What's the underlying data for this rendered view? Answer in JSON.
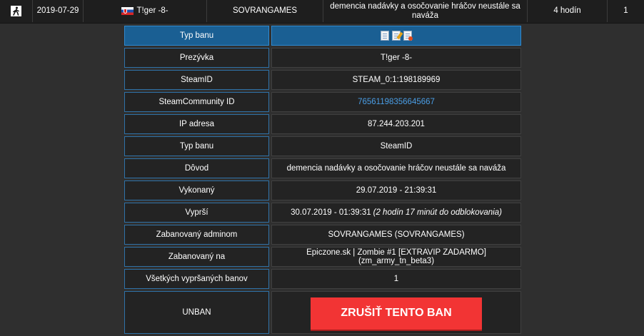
{
  "ban_row": {
    "game_icon": "person-walking-icon",
    "date": "2019-07-29",
    "player": "T!ger -8-",
    "country_flag": "slovakia-flag-icon",
    "admin": "SOVRANGAMES",
    "reason": "demencia nadávky a osočovanie hráčov neustále sa naváža",
    "length": "4 hodín",
    "count": "1"
  },
  "details": {
    "header": {
      "label": "Typ banu",
      "icons": [
        "document-icon",
        "edit-document-icon",
        "delete-document-icon"
      ]
    },
    "rows": [
      {
        "label": "Prezývka",
        "value": "T!ger -8-"
      },
      {
        "label": "SteamID",
        "value": "STEAM_0:1:198189969"
      },
      {
        "label": "SteamCommunity ID",
        "value": "76561198356645667"
      },
      {
        "label": "IP adresa",
        "value": "87.244.203.201"
      },
      {
        "label": "Typ banu",
        "value": "SteamID"
      },
      {
        "label": "Dôvod",
        "value": "demencia nadávky a osočovanie hráčov neustále sa naváža"
      },
      {
        "label": "Vykonaný",
        "value": "29.07.2019 - 21:39:31"
      },
      {
        "label": "Vyprší",
        "value": "30.07.2019 - 01:39:31",
        "note": "(2 hodín 17 minút do odblokovania)"
      },
      {
        "label": "Zabanovaný adminom",
        "value": "SOVRANGAMES (SOVRANGAMES)"
      },
      {
        "label": "Zabanovaný na",
        "value": "Epiczone.sk | Zombie #1 [EXTRAVIP ZADARMO] (zm_army_tn_beta3)"
      },
      {
        "label": "Všetkých vypršaných banov",
        "value": "1"
      }
    ],
    "unban": {
      "label": "UNBAN",
      "button_label": "ZRUŠIŤ TENTO BAN"
    }
  },
  "colors": {
    "background": "#2f2f2f",
    "header_blue": "#1a5f93",
    "label_border": "#2f72a8",
    "link": "#4a9ee6",
    "unban_button": "#f23434"
  }
}
